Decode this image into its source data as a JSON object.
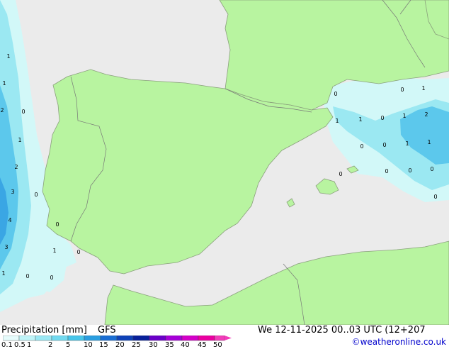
{
  "title": {
    "left_label": "Precipitation [mm]",
    "model": "GFS",
    "valid_time": "We 12-11-2025 00..03 UTC (12+207"
  },
  "legend": {
    "ticks": [
      "0.1",
      "0.5",
      "1",
      "2",
      "5",
      "10",
      "15",
      "20",
      "25",
      "30",
      "35",
      "40",
      "45",
      "50"
    ],
    "colors": [
      "#e6fcfc",
      "#bff4f8",
      "#9ae8f4",
      "#72daf0",
      "#48c6ea",
      "#2a9ee0",
      "#1a6ed4",
      "#0f42b8",
      "#08209a",
      "#6a00c8",
      "#a600d8",
      "#d400c8",
      "#ea00a0",
      "#f23cba"
    ]
  },
  "credit": "©weatheronline.co.uk",
  "colors": {
    "sea": "#ebebeb",
    "land": "#b8f4a0",
    "precip_light": "#d2f8f8",
    "precip_mid": "#9be8f2",
    "precip_heavy": "#5cc8ec",
    "precip_max": "#3aa6e4"
  },
  "precip_labels": [
    {
      "id": "w1",
      "text": "1"
    },
    {
      "id": "w2",
      "text": "1"
    },
    {
      "id": "w3",
      "text": "2"
    },
    {
      "id": "w4",
      "text": "0"
    },
    {
      "id": "w5",
      "text": "1"
    },
    {
      "id": "w6",
      "text": "2"
    },
    {
      "id": "w7",
      "text": "3"
    },
    {
      "id": "w8",
      "text": "0"
    },
    {
      "id": "w9",
      "text": "4"
    },
    {
      "id": "w10",
      "text": "0"
    },
    {
      "id": "w11",
      "text": "3"
    },
    {
      "id": "w12",
      "text": "1"
    },
    {
      "id": "w13",
      "text": "0"
    },
    {
      "id": "w14",
      "text": "1"
    },
    {
      "id": "w15",
      "text": "0"
    },
    {
      "id": "w16",
      "text": "0"
    },
    {
      "id": "e1",
      "text": "0"
    },
    {
      "id": "e2",
      "text": "0"
    },
    {
      "id": "e3",
      "text": "1"
    },
    {
      "id": "e4",
      "text": "1"
    },
    {
      "id": "e5",
      "text": "1"
    },
    {
      "id": "e6",
      "text": "0"
    },
    {
      "id": "e7",
      "text": "1"
    },
    {
      "id": "e8",
      "text": "2"
    },
    {
      "id": "e9",
      "text": "0"
    },
    {
      "id": "e10",
      "text": "0"
    },
    {
      "id": "e11",
      "text": "1"
    },
    {
      "id": "e12",
      "text": "1"
    },
    {
      "id": "e13",
      "text": "0"
    },
    {
      "id": "e14",
      "text": "0"
    },
    {
      "id": "e15",
      "text": "0"
    },
    {
      "id": "e16",
      "text": "0"
    },
    {
      "id": "e17",
      "text": "0"
    }
  ]
}
